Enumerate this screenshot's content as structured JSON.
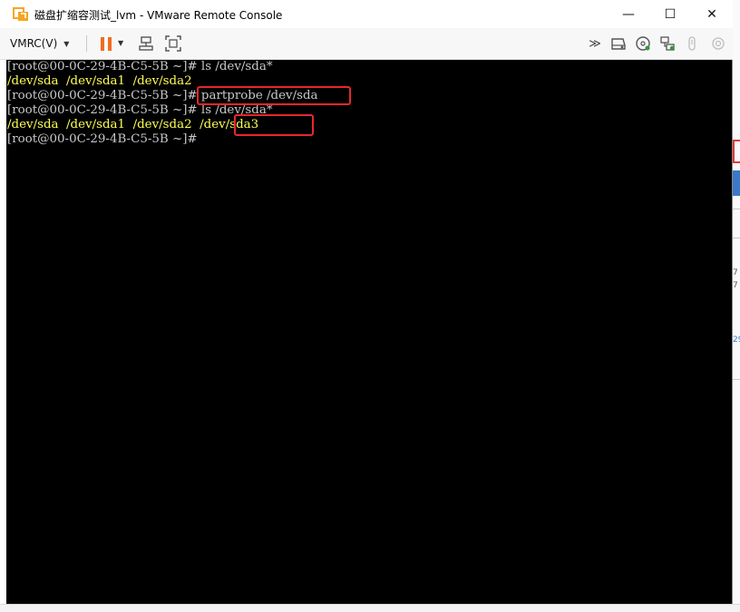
{
  "window": {
    "title": "磁盘扩缩容测试_lvm - VMware Remote Console",
    "minimize_glyph": "—",
    "maximize_glyph": "☐",
    "close_glyph": "✕"
  },
  "toolbar": {
    "vmrc_menu_label": "VMRC(V)",
    "icons": [
      "pause-icon",
      "send-ctrl-alt-del-icon",
      "fullscreen-icon",
      "forward-icon",
      "hard-disk-icon",
      "cd-dvd-icon",
      "network-adapter-icon",
      "usb-icon",
      "sound-icon"
    ],
    "accent_color": "#f26b21",
    "forward_glyph": "≫"
  },
  "console": {
    "lines": [
      {
        "prompt": "[root@00-0C-29-4B-C5-5B ~]# ",
        "command": "ls /dev/sda*"
      },
      {
        "output": "/dev/sda  /dev/sda1  /dev/sda2"
      },
      {
        "prompt": "[root@00-0C-29-4B-C5-5B ~]# ",
        "command": "partprobe /dev/sda"
      },
      {
        "prompt": "[root@00-0C-29-4B-C5-5B ~]# ",
        "command": "ls /dev/sda*"
      },
      {
        "output_a": "/dev/sda  /dev/sda1  /dev/sda2  ",
        "output_b": "/dev/sda3"
      },
      {
        "prompt": "[root@00-0C-29-4B-C5-5B ~]#",
        "command": ""
      }
    ],
    "prompt_color": "#c8c8c8",
    "output_color": "#ffff55",
    "highlight_color": "#e8272b"
  },
  "background": {
    "edge_text_1": "7",
    "edge_text_2": "7",
    "edge_text_3": "29"
  }
}
